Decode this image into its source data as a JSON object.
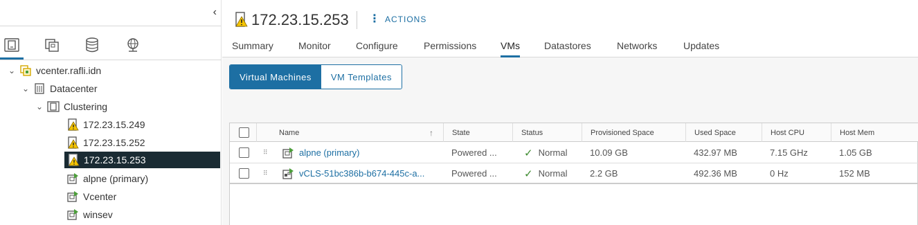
{
  "navigator": {
    "collapse_glyph": "‹",
    "tabs": [
      {
        "icon": "hosts-clusters-icon",
        "active": true
      },
      {
        "icon": "vms-templates-icon",
        "active": false
      },
      {
        "icon": "storage-icon",
        "active": false
      },
      {
        "icon": "networking-icon",
        "active": false
      }
    ],
    "tree": [
      {
        "label": "vcenter.rafli.idn",
        "icon": "vcenter-icon",
        "expanded": true
      },
      {
        "label": "Datacenter",
        "icon": "datacenter-icon",
        "expanded": true
      },
      {
        "label": "Clustering",
        "icon": "cluster-icon",
        "expanded": true
      },
      {
        "label": "172.23.15.249",
        "icon": "host-warning-icon"
      },
      {
        "label": "172.23.15.252",
        "icon": "host-warning-icon"
      },
      {
        "label": "172.23.15.253",
        "icon": "host-warning-icon",
        "selected": true
      },
      {
        "label": "alpne (primary)",
        "icon": "vm-icon"
      },
      {
        "label": "Vcenter",
        "icon": "vm-icon"
      },
      {
        "label": "winsev",
        "icon": "vm-icon"
      }
    ]
  },
  "header": {
    "title": "172.23.15.253",
    "title_icon": "host-warning-icon",
    "actions_label": "ACTIONS",
    "tabs": [
      "Summary",
      "Monitor",
      "Configure",
      "Permissions",
      "VMs",
      "Datastores",
      "Networks",
      "Updates"
    ],
    "active_tab": "VMs"
  },
  "segmented": {
    "options": [
      "Virtual Machines",
      "VM Templates"
    ],
    "active": "Virtual Machines"
  },
  "grid": {
    "columns": [
      "Name",
      "State",
      "Status",
      "Provisioned Space",
      "Used Space",
      "Host CPU",
      "Host Mem"
    ],
    "sort_glyph": "↑",
    "rows": [
      {
        "name": "alpne (primary)",
        "icon": "vm-icon",
        "state": "Powered ...",
        "status": "Normal",
        "provisioned": "10.09 GB",
        "used": "432.97 MB",
        "cpu": "7.15 GHz",
        "mem": "1.05 GB"
      },
      {
        "name": "vCLS-51bc386b-b674-445c-a...",
        "icon": "vcls-vm-icon",
        "state": "Powered ...",
        "status": "Normal",
        "provisioned": "2.2 GB",
        "used": "492.36 MB",
        "cpu": "0 Hz",
        "mem": "152 MB"
      }
    ]
  },
  "colors": {
    "accent": "#1d6fa3",
    "selected_row": "#1a2b33",
    "status_ok": "#3c8a2e",
    "warning": "#f5c400",
    "vm_green": "#4c9e3a"
  }
}
